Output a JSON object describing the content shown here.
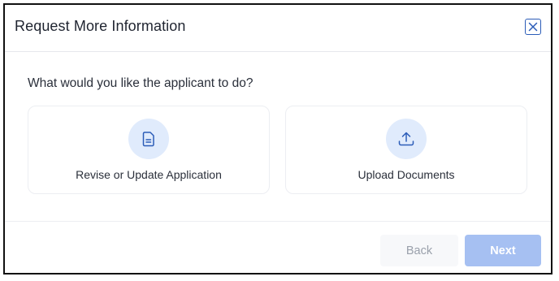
{
  "dialog": {
    "title": "Request More Information",
    "close_icon": "close-x-icon",
    "prompt": "What would you like the applicant to do?"
  },
  "options": [
    {
      "label": "Revise or Update Application",
      "icon": "document-icon"
    },
    {
      "label": "Upload Documents",
      "icon": "upload-icon"
    }
  ],
  "footer": {
    "back_label": "Back",
    "next_label": "Next"
  },
  "colors": {
    "accent": "#2b5cb8",
    "icon_bg": "#e0ebfc",
    "next_disabled_bg": "#a6c0f2",
    "back_bg": "#f7f8fa"
  }
}
